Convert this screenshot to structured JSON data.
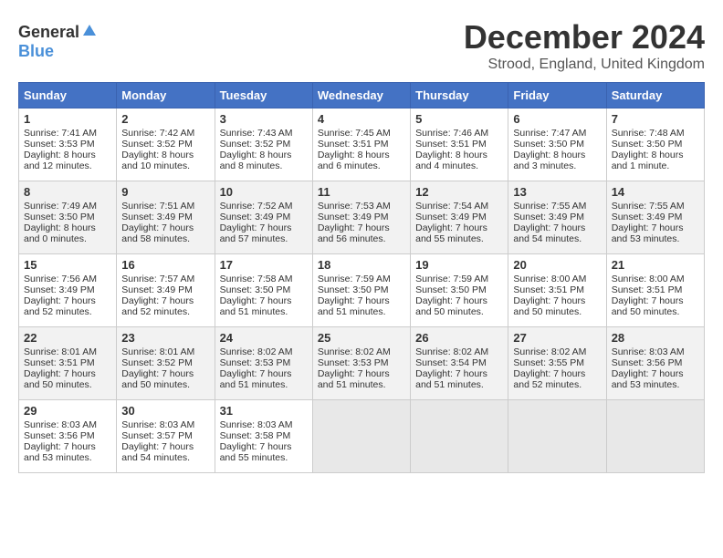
{
  "logo": {
    "general": "General",
    "blue": "Blue"
  },
  "title": "December 2024",
  "location": "Strood, England, United Kingdom",
  "days_of_week": [
    "Sunday",
    "Monday",
    "Tuesday",
    "Wednesday",
    "Thursday",
    "Friday",
    "Saturday"
  ],
  "weeks": [
    [
      {
        "day": 1,
        "sunrise": "7:41 AM",
        "sunset": "3:53 PM",
        "daylight": "8 hours and 12 minutes."
      },
      {
        "day": 2,
        "sunrise": "7:42 AM",
        "sunset": "3:52 PM",
        "daylight": "8 hours and 10 minutes."
      },
      {
        "day": 3,
        "sunrise": "7:43 AM",
        "sunset": "3:52 PM",
        "daylight": "8 hours and 8 minutes."
      },
      {
        "day": 4,
        "sunrise": "7:45 AM",
        "sunset": "3:51 PM",
        "daylight": "8 hours and 6 minutes."
      },
      {
        "day": 5,
        "sunrise": "7:46 AM",
        "sunset": "3:51 PM",
        "daylight": "8 hours and 4 minutes."
      },
      {
        "day": 6,
        "sunrise": "7:47 AM",
        "sunset": "3:50 PM",
        "daylight": "8 hours and 3 minutes."
      },
      {
        "day": 7,
        "sunrise": "7:48 AM",
        "sunset": "3:50 PM",
        "daylight": "8 hours and 1 minute."
      }
    ],
    [
      {
        "day": 8,
        "sunrise": "7:49 AM",
        "sunset": "3:50 PM",
        "daylight": "8 hours and 0 minutes."
      },
      {
        "day": 9,
        "sunrise": "7:51 AM",
        "sunset": "3:49 PM",
        "daylight": "7 hours and 58 minutes."
      },
      {
        "day": 10,
        "sunrise": "7:52 AM",
        "sunset": "3:49 PM",
        "daylight": "7 hours and 57 minutes."
      },
      {
        "day": 11,
        "sunrise": "7:53 AM",
        "sunset": "3:49 PM",
        "daylight": "7 hours and 56 minutes."
      },
      {
        "day": 12,
        "sunrise": "7:54 AM",
        "sunset": "3:49 PM",
        "daylight": "7 hours and 55 minutes."
      },
      {
        "day": 13,
        "sunrise": "7:55 AM",
        "sunset": "3:49 PM",
        "daylight": "7 hours and 54 minutes."
      },
      {
        "day": 14,
        "sunrise": "7:55 AM",
        "sunset": "3:49 PM",
        "daylight": "7 hours and 53 minutes."
      }
    ],
    [
      {
        "day": 15,
        "sunrise": "7:56 AM",
        "sunset": "3:49 PM",
        "daylight": "7 hours and 52 minutes."
      },
      {
        "day": 16,
        "sunrise": "7:57 AM",
        "sunset": "3:49 PM",
        "daylight": "7 hours and 52 minutes."
      },
      {
        "day": 17,
        "sunrise": "7:58 AM",
        "sunset": "3:50 PM",
        "daylight": "7 hours and 51 minutes."
      },
      {
        "day": 18,
        "sunrise": "7:59 AM",
        "sunset": "3:50 PM",
        "daylight": "7 hours and 51 minutes."
      },
      {
        "day": 19,
        "sunrise": "7:59 AM",
        "sunset": "3:50 PM",
        "daylight": "7 hours and 50 minutes."
      },
      {
        "day": 20,
        "sunrise": "8:00 AM",
        "sunset": "3:51 PM",
        "daylight": "7 hours and 50 minutes."
      },
      {
        "day": 21,
        "sunrise": "8:00 AM",
        "sunset": "3:51 PM",
        "daylight": "7 hours and 50 minutes."
      }
    ],
    [
      {
        "day": 22,
        "sunrise": "8:01 AM",
        "sunset": "3:51 PM",
        "daylight": "7 hours and 50 minutes."
      },
      {
        "day": 23,
        "sunrise": "8:01 AM",
        "sunset": "3:52 PM",
        "daylight": "7 hours and 50 minutes."
      },
      {
        "day": 24,
        "sunrise": "8:02 AM",
        "sunset": "3:53 PM",
        "daylight": "7 hours and 51 minutes."
      },
      {
        "day": 25,
        "sunrise": "8:02 AM",
        "sunset": "3:53 PM",
        "daylight": "7 hours and 51 minutes."
      },
      {
        "day": 26,
        "sunrise": "8:02 AM",
        "sunset": "3:54 PM",
        "daylight": "7 hours and 51 minutes."
      },
      {
        "day": 27,
        "sunrise": "8:02 AM",
        "sunset": "3:55 PM",
        "daylight": "7 hours and 52 minutes."
      },
      {
        "day": 28,
        "sunrise": "8:03 AM",
        "sunset": "3:56 PM",
        "daylight": "7 hours and 53 minutes."
      }
    ],
    [
      {
        "day": 29,
        "sunrise": "8:03 AM",
        "sunset": "3:56 PM",
        "daylight": "7 hours and 53 minutes."
      },
      {
        "day": 30,
        "sunrise": "8:03 AM",
        "sunset": "3:57 PM",
        "daylight": "7 hours and 54 minutes."
      },
      {
        "day": 31,
        "sunrise": "8:03 AM",
        "sunset": "3:58 PM",
        "daylight": "7 hours and 55 minutes."
      },
      null,
      null,
      null,
      null
    ]
  ]
}
